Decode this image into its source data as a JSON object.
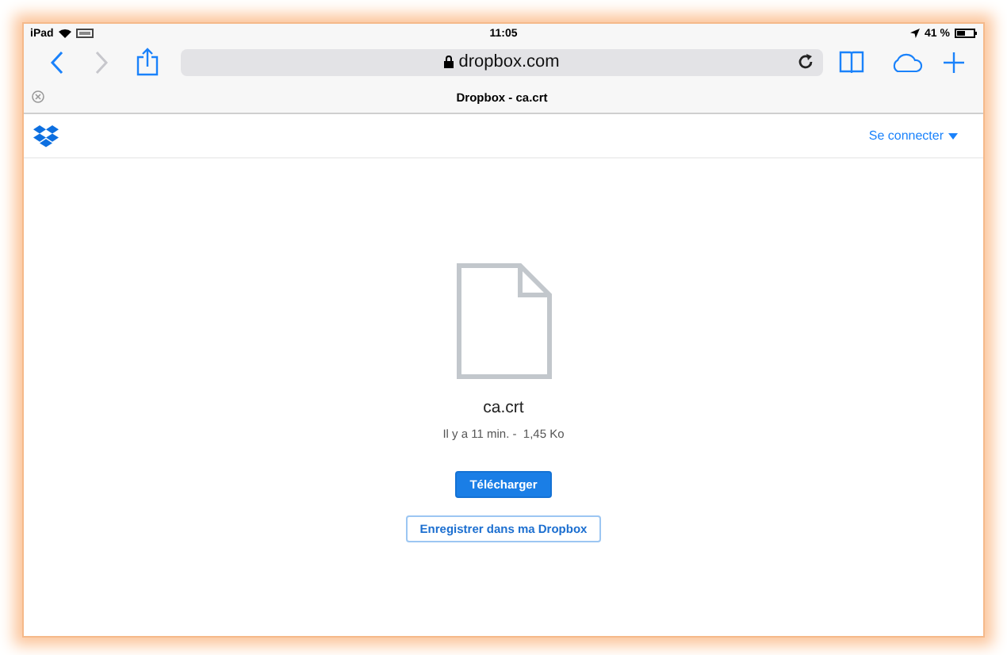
{
  "status_bar": {
    "device": "iPad",
    "time": "11:05",
    "battery": "41 %"
  },
  "browser": {
    "address": "dropbox.com",
    "tab_title": "Dropbox - ca.crt"
  },
  "site_header": {
    "sign_in": "Se connecter"
  },
  "file": {
    "name": "ca.crt",
    "meta": "Il y a 11 min. -  1,45 Ko"
  },
  "buttons": [
    {
      "label": "Télécharger",
      "kind": "primary"
    },
    {
      "label": "Enregistrer dans ma Dropbox",
      "kind": "secondary"
    }
  ]
}
